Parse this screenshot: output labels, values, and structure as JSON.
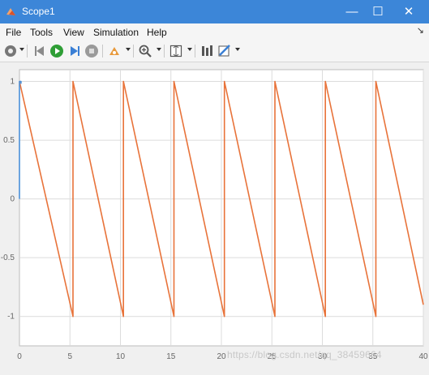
{
  "window": {
    "title": "Scope1",
    "minimize_label": "—",
    "maximize_label": "☐",
    "close_label": "✕"
  },
  "menu": {
    "items": [
      "File",
      "Tools",
      "View",
      "Simulation",
      "Help"
    ],
    "overflow_label": "↘"
  },
  "toolbar": {
    "icons": [
      "settings-icon",
      "step-back-icon",
      "run-icon",
      "step-forward-icon",
      "stop-icon",
      "highlight-icon",
      "zoom-icon",
      "fit-icon",
      "cursor-icon",
      "style-icon"
    ]
  },
  "colors": {
    "titlebar": "#3c86d8",
    "plot_bg": "#ffffff",
    "signal_1": "#e8733a",
    "signal_2": "#4a90d9",
    "grid": "#dcdcdc"
  },
  "watermark": "https://blog.csdn.net/qq_38459664",
  "chart_data": {
    "type": "line",
    "xlim": [
      0,
      40
    ],
    "ylim": [
      -1.25,
      1.1
    ],
    "xticks": [
      0,
      5,
      10,
      15,
      20,
      25,
      30,
      35,
      40
    ],
    "yticks": [
      1,
      0.5,
      0,
      -0.5,
      -1
    ],
    "xtick_labels": [
      "0",
      "5",
      "10",
      "15",
      "20",
      "25",
      "30",
      "35",
      "40"
    ],
    "ytick_labels": [
      "1",
      "0.5",
      "0",
      "-0.5",
      "-1"
    ],
    "grid": true,
    "series": [
      {
        "color": "#e8733a",
        "x": [
          0,
          5.3,
          5.3,
          10.3,
          10.3,
          15.3,
          15.3,
          20.3,
          20.3,
          25.3,
          25.3,
          30.3,
          30.3,
          35.3,
          35.3,
          40
        ],
        "y": [
          1,
          -1,
          1,
          -1,
          1,
          -1,
          1,
          -1,
          1,
          -1,
          1,
          -1,
          1,
          -1,
          1,
          -0.9
        ]
      },
      {
        "color": "#4a90d9",
        "x": [
          0,
          0,
          0.15,
          0.15
        ],
        "y": [
          0,
          1,
          1,
          0.98
        ]
      }
    ]
  }
}
